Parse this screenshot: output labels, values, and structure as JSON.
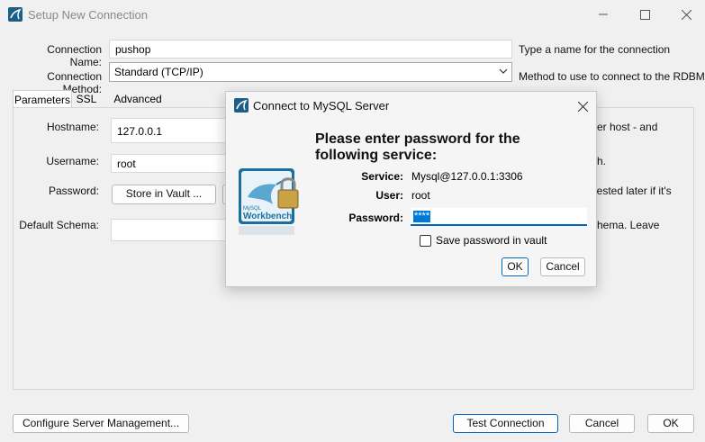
{
  "window": {
    "title": "Setup New Connection"
  },
  "form": {
    "connection_name_label": "Connection Name:",
    "connection_name_value": "pushop",
    "connection_name_hint": "Type a name for the connection",
    "connection_method_label": "Connection Method:",
    "connection_method_value": "Standard (TCP/IP)",
    "connection_method_hint": "Method to use to connect to the RDBMS"
  },
  "tabs": [
    {
      "label": "Parameters"
    },
    {
      "label": "SSL"
    },
    {
      "label": "Advanced"
    }
  ],
  "parameters": {
    "hostname_label": "Hostname:",
    "hostname_value": "127.0.0.1",
    "hostname_hint_partial": "er host - and",
    "username_label": "Username:",
    "username_value": "root",
    "username_hint_partial": "h.",
    "password_label": "Password:",
    "store_vault_button": "Store in Vault ...",
    "password_hint_partial": "uested later if it's",
    "default_schema_label": "Default Schema:",
    "default_schema_hint_partial": "hema. Leave"
  },
  "footer": {
    "configure_button": "Configure Server Management...",
    "test_button": "Test Connection",
    "cancel_button": "Cancel",
    "ok_button": "OK"
  },
  "dialog": {
    "title": "Connect to MySQL Server",
    "heading": "Please enter password for the following service:",
    "service_label": "Service:",
    "service_value": "Mysql@127.0.0.1:3306",
    "user_label": "User:",
    "user_value": "root",
    "password_label": "Password:",
    "password_masked": "****",
    "save_password_label": "Save password in vault",
    "save_password_checked": false,
    "ok_button": "OK",
    "cancel_button": "Cancel",
    "logo_text_small": "MySQL",
    "logo_text": "Workbench"
  },
  "colors": {
    "accent": "#0067c0",
    "selection": "#0078d7",
    "logo_blue": "#1b6fa0"
  }
}
